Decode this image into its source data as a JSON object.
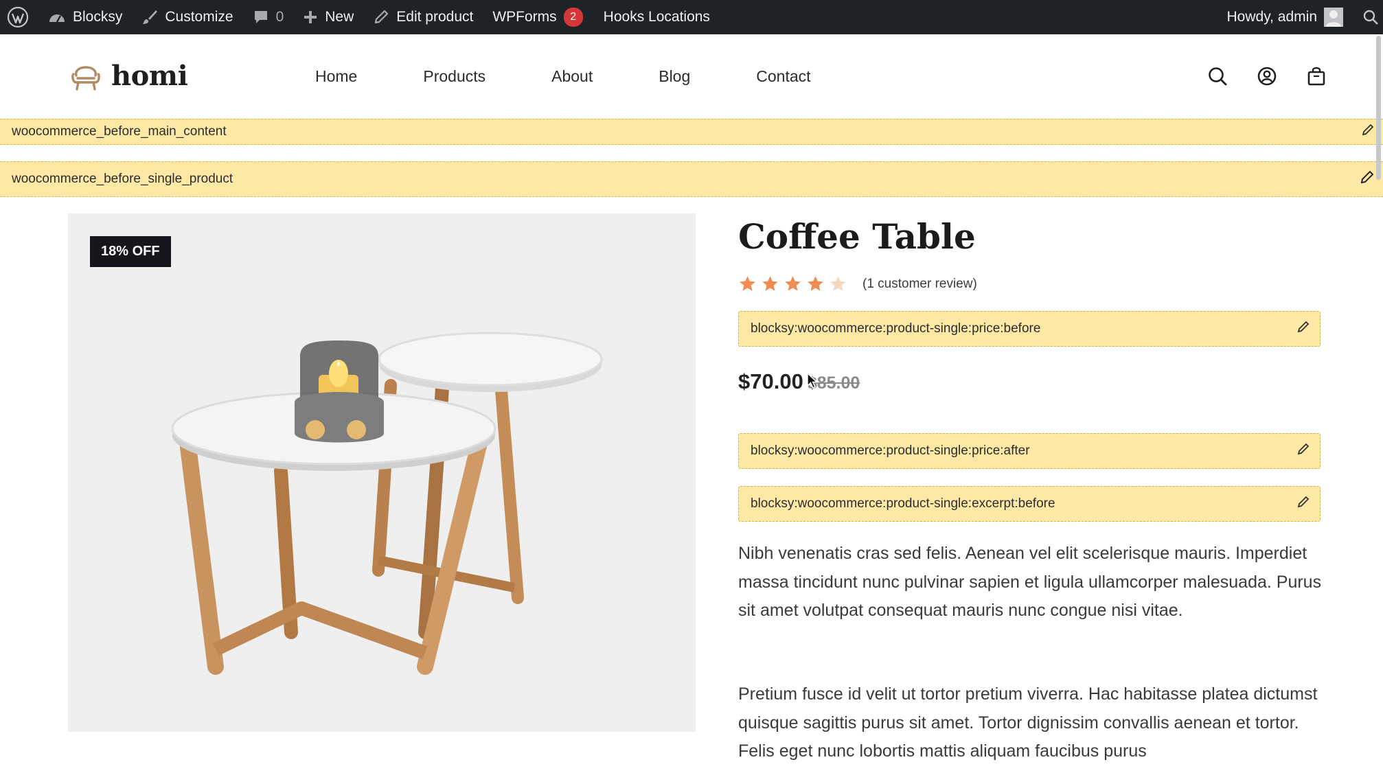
{
  "admin_bar": {
    "site_name": "Blocksy",
    "customize": "Customize",
    "comments_count": "0",
    "new_label": "New",
    "edit_product": "Edit product",
    "wpforms_label": "WPForms",
    "wpforms_count": "2",
    "hooks_locations": "Hooks Locations",
    "greeting": "Howdy, admin"
  },
  "site": {
    "logo_text": "homi",
    "nav": [
      "Home",
      "Products",
      "About",
      "Blog",
      "Contact"
    ]
  },
  "hooks": {
    "before_main_content": "woocommerce_before_main_content",
    "before_single_product": "woocommerce_before_single_product",
    "price_before": "blocksy:woocommerce:product-single:price:before",
    "price_after": "blocksy:woocommerce:product-single:price:after",
    "excerpt_before": "blocksy:woocommerce:product-single:excerpt:before"
  },
  "product": {
    "sale_badge": "18% OFF",
    "title": "Coffee Table",
    "rating": 4,
    "rating_max": 5,
    "review_text": "(1 customer review)",
    "price": "$70.00",
    "regular_price": "$85.00",
    "description": [
      "Nibh venenatis cras sed felis. Aenean vel elit scelerisque mauris. Imperdiet massa tincidunt nunc pulvinar sapien et ligula ullamcorper malesuada. Purus sit amet volutpat consequat mauris nunc congue nisi vitae.",
      "Pretium fusce id velit ut tortor pretium viverra. Hac habitasse platea dictumst quisque sagittis purus sit amet. Tortor dignissim convallis aenean et tortor. Felis eget nunc lobortis mattis aliquam faucibus purus"
    ]
  },
  "colors": {
    "admin_bar_bg": "#1d2327",
    "hook_bg": "#fde9a5",
    "star_filled": "#f08c52",
    "star_empty": "#f7d6c1",
    "badge_bg": "#15171c",
    "notification": "#d63638"
  },
  "icons": [
    "wordpress-icon",
    "dashboard-icon",
    "brush-icon",
    "comment-icon",
    "plus-icon",
    "pencil-icon",
    "avatar-icon",
    "search-icon",
    "chair-logo-icon",
    "user-icon",
    "bag-icon",
    "edit-pencil-icon",
    "star-icon"
  ]
}
